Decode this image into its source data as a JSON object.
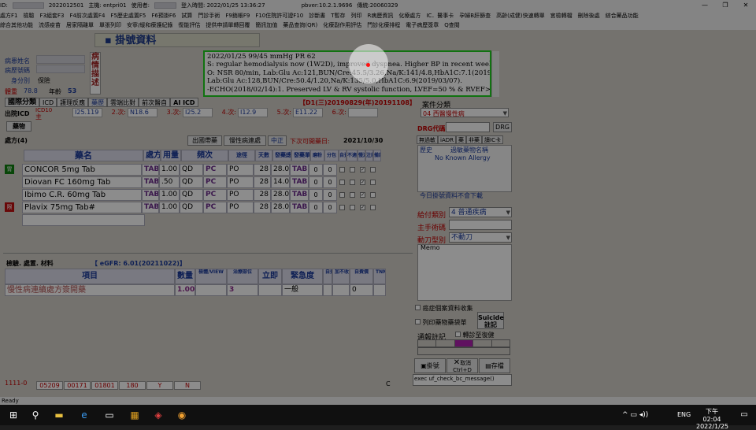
{
  "titlebar": {
    "id_label": "ID:",
    "id_value": "2022012501",
    "host_label": "主機: entpri01",
    "user_label": "使用者:",
    "login_time": "登入時間: 2022/01/25 13:36:27",
    "pbver": "pbver:10.2.1.9696",
    "version": "傳統:20060329"
  },
  "menu1": [
    "處方F1",
    "檢驗",
    "F3組套F3",
    "F4前次處置F4",
    "F5歷史處置F5",
    "F6預掛F6",
    "試算",
    "門診手術",
    "F9銷帳F9",
    "F10住院許可證F10",
    "診斷書",
    "T暫存",
    "列印",
    "R病歷資訊",
    "化療處方",
    "IC．醫事卡",
    "孕婦B肝篩查",
    "高齡(成健)快速轉單",
    "宮檢轉檔",
    "刪除後處",
    "綜合藥品功能"
  ],
  "menu2": [
    "綜合其他功能",
    "流感疫苗",
    "居家隔離單",
    "單張列印",
    "安寧/緩和療護紀錄",
    "復能評估",
    "提供申請單轉回覆",
    "簡訊加值",
    "藥品查詢(QR)",
    "化療副作用評估",
    "門診化療排程",
    "電子病歷簽章",
    "Q查閱"
  ],
  "window_title": "掛號資料",
  "patient": {
    "name_label": "病患姓名",
    "chart_label": "病歷號碼",
    "id_label": "身分別",
    "id_value": "保險",
    "dept_label": "體重",
    "weight": "78.8",
    "age_label": "年齡",
    "age": "53"
  },
  "vertical_label": "病情描述",
  "notes": [
    "2022/01/25  99/45 mmHg PR 62",
    "S: regular hemodialysis now (1W2D), improved dyspnea. Higher BP in recent weeks.",
    "O: NSR 80/min,  Lab:Glu Ac:121,BUN/Cre:45.5/3.26,Na/K:141/4.8,HbA1C:7.1(2019/05/02).",
    "Lab:Glu Ac:128,BUN/Cre:50.4/1.20,Na/K:135/5.0,HbA1C:6.9(2019/03/07).",
    "-ECHO(2018/02/14):1. Preserved LV & RV systolic function, LVEF=50 % & RVEF>55 %.2. Dilated: LA."
  ],
  "tabs": [
    "國際分類",
    "ICD",
    "護理反應",
    "藥歷",
    "雲端比對",
    "前次醫自",
    "AI ICD"
  ],
  "date_range": "【D1(三)20190829(年)20191108】",
  "icd": {
    "main_label": "出院ICD",
    "icd10_label": "ICD10",
    "primary": "主",
    "codes": [
      {
        "n": "",
        "c": "I25.119"
      },
      {
        "n": "2.次:",
        "c": "N18.6"
      },
      {
        "n": "3.次:",
        "c": "I25.2"
      },
      {
        "n": "4.次:",
        "c": "I12.9"
      },
      {
        "n": "5.次:",
        "c": "E11.22"
      },
      {
        "n": "6.次:",
        "c": ""
      }
    ]
  },
  "case_class": {
    "label": "案件分類",
    "value": "04  西醫慢性病"
  },
  "drg": {
    "label": "DRG代碼",
    "btn": "DRG"
  },
  "med_tab": "藥物",
  "rx": {
    "title": "處方(4)",
    "outpatient": "出國帶藥",
    "chronic": "慢性病連處",
    "middle": "中正",
    "next_date_label": "下次可開藥日:",
    "next_date": "2021/10/30",
    "headers": [
      "藥名",
      "處方單位",
      "用量",
      "頻次",
      "途徑",
      "天數",
      "發藥總量",
      "發藥單位",
      "磨粉",
      "分包",
      "自費",
      "不適自費",
      "慢連",
      "注射",
      "備註"
    ],
    "rows": [
      {
        "tag": "胃",
        "name": "CONCOR 5mg Tab",
        "unit": "TAB",
        "dose": "1.00",
        "freq": "QD",
        "freq2": "PC",
        "route": "PO",
        "days": "28",
        "total": "28.0",
        "dunit": "TAB",
        "g": "0",
        "p": "0"
      },
      {
        "tag": "",
        "name": "Diovan FC 160mg Tab",
        "unit": "TAB",
        "dose": ".50",
        "freq": "QD",
        "freq2": "PC",
        "route": "PO",
        "days": "28",
        "total": "14.0",
        "dunit": "TAB",
        "g": "0",
        "p": "0"
      },
      {
        "tag": "",
        "name": "Ibimo C.R. 60mg Tab",
        "unit": "TAB",
        "dose": "1.00",
        "freq": "QD",
        "freq2": "PC",
        "route": "PO",
        "days": "28",
        "total": "28.0",
        "dunit": "TAB",
        "g": "0",
        "p": "0"
      },
      {
        "tag": "限",
        "name": "Plavix 75mg Tab#",
        "unit": "TAB",
        "dose": "1.00",
        "freq": "QD",
        "freq2": "PC",
        "route": "PO",
        "days": "28",
        "total": "28.0",
        "dunit": "TAB",
        "g": "0",
        "p": "0"
      }
    ]
  },
  "right": {
    "tabs": [
      "無過敏",
      "iADR",
      "藥",
      "非藥",
      "讀IC卡"
    ],
    "hist": "歷史",
    "allergy_label": "過敏藥物名稱",
    "allergy": "No Known Allergy",
    "today": "今日掛號資料不會下載",
    "pay_label": "給付類別",
    "pay_value": "4  普通疾病",
    "surgery_label": "主手術碼",
    "knife_label": "動刀型別",
    "knife_value": "不動刀",
    "memo": "Memo"
  },
  "exam": {
    "title": "檢驗. 處置. 材料",
    "egfr": "【 eGFR: 6.01(20211022)】",
    "headers": [
      "項目",
      "數量",
      "檢體/VIEW",
      "治療部位",
      "立即",
      "緊急度",
      "自費",
      "加不收自費",
      "自費價",
      "TNM"
    ],
    "row": {
      "item": "慢性病連續處方簽開藥",
      "qty": "1.00",
      "site": "3",
      "urgent": "一般",
      "self": "0"
    }
  },
  "right_bottom": {
    "cancer": "癌症個案資料收集",
    "print": "列印藥物藥袋單",
    "suicide": "Suicide 註記",
    "notify": "通報註記",
    "transfer": "轉診至復健",
    "reg_btn": "掛號",
    "cancel_btn": "取消 Ctrl+D",
    "save_btn": "存檔",
    "message": "exec uf_check_bc_message()"
  },
  "status_codes": [
    "05209",
    "00171",
    "01801",
    "180",
    "Y",
    "N"
  ],
  "status_left": "1111-0",
  "statusbar": "Ready",
  "clock": {
    "time": "下午 02:04",
    "date": "2022/1/25",
    "lang": "ENG"
  }
}
